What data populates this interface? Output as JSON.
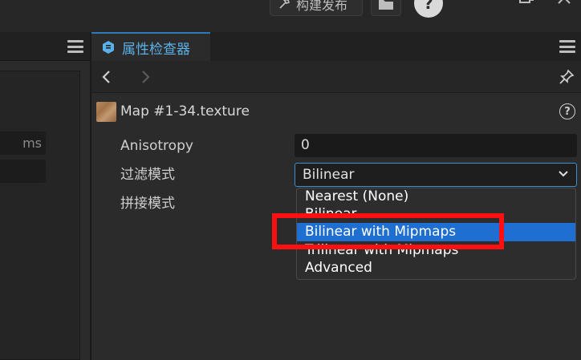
{
  "titlebar": {
    "build_label": "构建发布",
    "build_icon": "hammer-icon",
    "folder_icon": "folder-icon",
    "help_label": "?"
  },
  "left_panel": {
    "field_unit": "ms",
    "field2_value": ""
  },
  "inspector": {
    "tab_title": "属性检查器",
    "asset_name": "Map #1-34.texture",
    "help_label": "?",
    "properties": [
      {
        "label": "Anisotropy",
        "value": "0"
      },
      {
        "label": "过滤模式",
        "value": "Bilinear"
      },
      {
        "label": "拼接模式",
        "value": ""
      }
    ]
  },
  "dropdown": {
    "options": [
      {
        "label": "Nearest (None)",
        "highlighted": false
      },
      {
        "label": "Bilinear",
        "highlighted": false
      },
      {
        "label": "Bilinear with Mipmaps",
        "highlighted": true
      },
      {
        "label": "Trilinear with Mipmaps",
        "highlighted": false
      },
      {
        "label": "Advanced",
        "highlighted": false
      }
    ]
  },
  "colors": {
    "accent": "#2f79b8",
    "highlight": "#1f6fd2",
    "annotation": "#ff1010"
  }
}
